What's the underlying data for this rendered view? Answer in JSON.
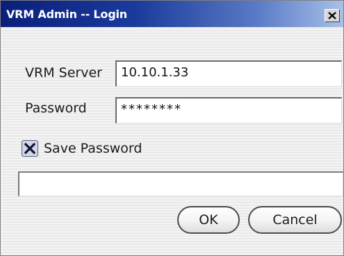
{
  "window": {
    "title": "VRM Admin -- Login"
  },
  "icons": {
    "close": "close-icon",
    "checkbox_mark": "check-x-icon"
  },
  "form": {
    "server_label": "VRM Server",
    "server_value": "10.10.1.33",
    "password_label": "Password",
    "password_value": "********",
    "save_password_label": "Save Password",
    "save_password_checked": true,
    "status_text": ""
  },
  "buttons": {
    "ok_label": "OK",
    "cancel_label": "Cancel"
  }
}
